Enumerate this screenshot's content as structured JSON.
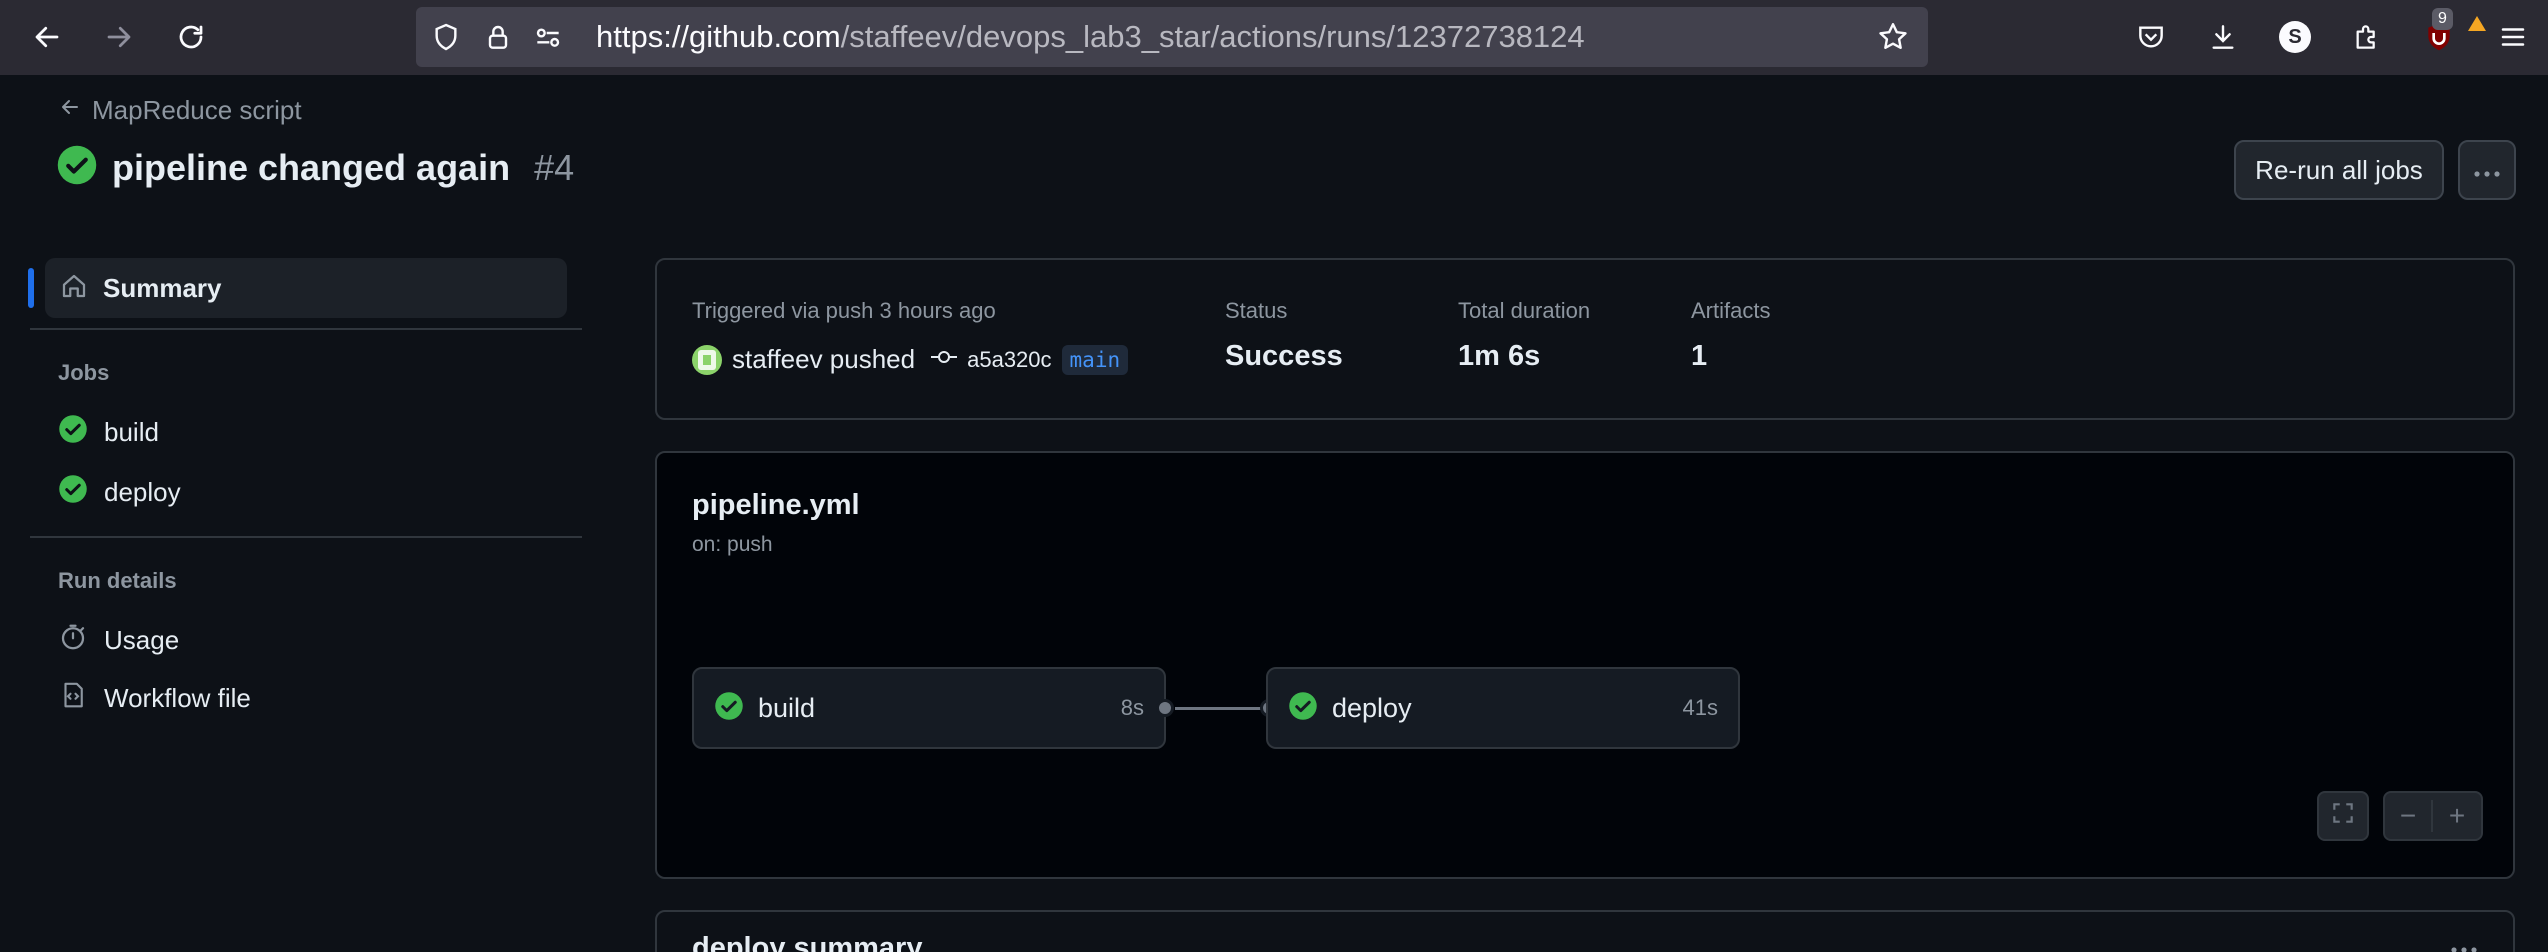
{
  "browser": {
    "url_host": "https://github.com",
    "url_path": "/staffeev/devops_lab3_star/actions/runs/12372738124",
    "ext_badge": "9",
    "account_initial": "S"
  },
  "page": {
    "back_label": "MapReduce script",
    "title": "pipeline changed again",
    "run_number": "#4",
    "rerun_label": "Re-run all jobs"
  },
  "sidebar": {
    "summary_label": "Summary",
    "jobs_heading": "Jobs",
    "jobs": [
      {
        "label": "build"
      },
      {
        "label": "deploy"
      }
    ],
    "run_details_heading": "Run details",
    "usage_label": "Usage",
    "workflow_file_label": "Workflow file"
  },
  "summary": {
    "trigger_text": "Triggered via push 3 hours ago",
    "actor": "staffeev pushed",
    "commit": "a5a320c",
    "branch": "main",
    "status_label": "Status",
    "status_value": "Success",
    "duration_label": "Total duration",
    "duration_value": "1m 6s",
    "artifacts_label": "Artifacts",
    "artifacts_value": "1"
  },
  "workflow": {
    "file": "pipeline.yml",
    "trigger": "on: push",
    "jobs": [
      {
        "name": "build",
        "time": "8s"
      },
      {
        "name": "deploy",
        "time": "41s"
      }
    ]
  },
  "deploy_summary": {
    "title": "deploy summary"
  },
  "colors": {
    "success": "#3fb950",
    "accent": "#1f6feb",
    "background": "#0d1117"
  }
}
